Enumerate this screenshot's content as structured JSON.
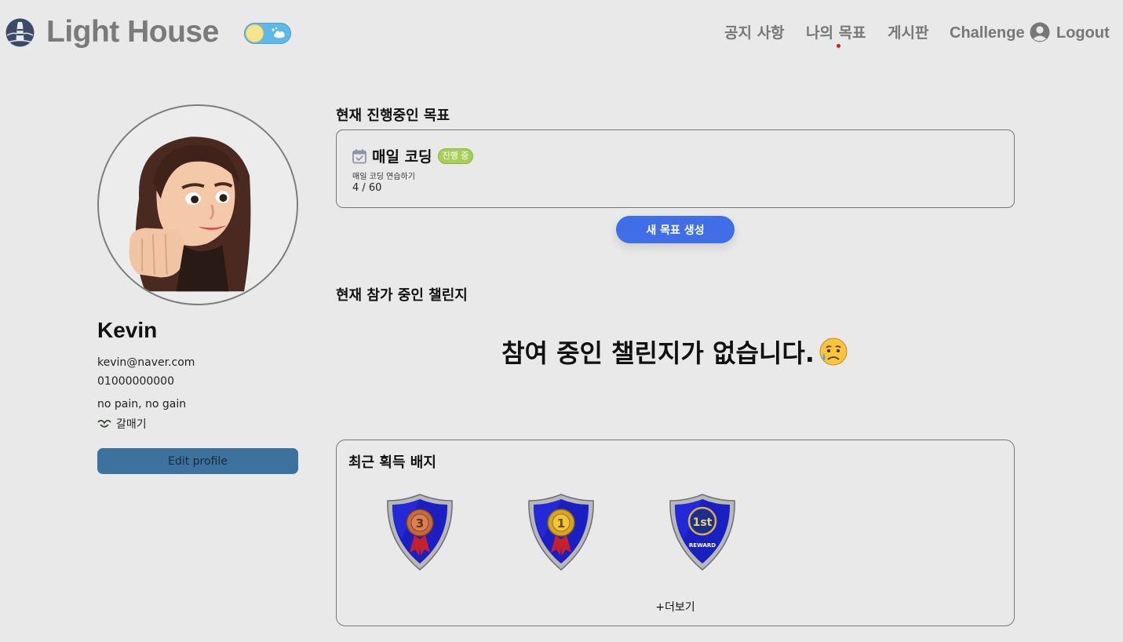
{
  "header": {
    "brand": "Light House",
    "nav": [
      {
        "label": "공지 사항"
      },
      {
        "label": "나의 목표"
      },
      {
        "label": "게시판"
      },
      {
        "label": "Challenge"
      },
      {
        "label": "Logout"
      }
    ]
  },
  "profile": {
    "name": "Kevin",
    "email": "kevin@naver.com",
    "phone": "01000000000",
    "motto": "no pain, no gain",
    "nickname": "갈매기",
    "edit_label": "Edit profile"
  },
  "goals": {
    "section_title": "현재 진행중인 목표",
    "items": [
      {
        "title": "매일 코딩",
        "status": "진행 중",
        "description": "매일 코딩 연습하기",
        "progress": "4 / 60"
      }
    ],
    "new_goal_label": "새 목표 생성"
  },
  "challenges": {
    "section_title": "현재 참가 중인 챌린지",
    "empty_message": "참여 중인 챌린지가 없습니다."
  },
  "badges": {
    "section_title": "최근 획득 배지",
    "items": [
      {
        "medal": "3",
        "color": "#c46b3c"
      },
      {
        "medal": "1",
        "color": "#d7a51e"
      },
      {
        "medal": "1st",
        "caption": "REWARD",
        "color": "#1d2f8a"
      }
    ],
    "more_label": "+더보기"
  },
  "colors": {
    "accent": "#3f6ee8",
    "edit_button": "#3d729e",
    "status_badge": "#a6cf5a",
    "nav_dot": "#ee1111"
  },
  "icons": [
    "lighthouse-logo-icon",
    "day-night-toggle",
    "user-circle-icon",
    "calendar-check-icon",
    "sad-tear-face-icon",
    "seagull-icon"
  ]
}
